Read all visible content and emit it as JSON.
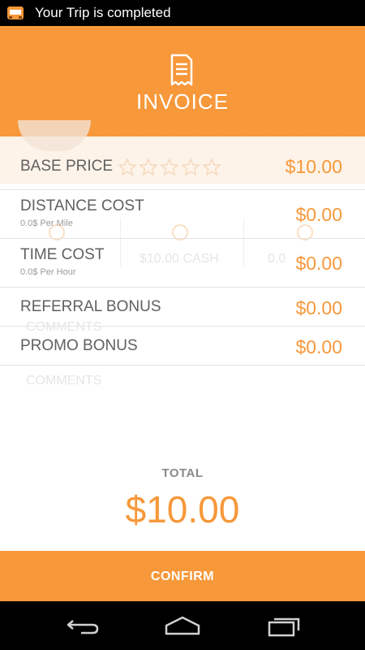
{
  "status_bar": {
    "notification_text": "Your Trip is completed"
  },
  "header": {
    "title": "INVOICE",
    "icon": "receipt-icon"
  },
  "background_ghost": {
    "cash_text": "$10.00 CASH",
    "partial_text": "0.0",
    "comments_text_1": "COMMENTS",
    "comments_text_2": "COMMENTS"
  },
  "invoice": {
    "base_price": {
      "label": "BASE PRICE",
      "amount": "$10.00",
      "rating": 0,
      "max_rating": 5
    },
    "distance_cost": {
      "label": "DISTANCE COST",
      "sub": "0.0$ Per Mile",
      "amount": "$0.00"
    },
    "time_cost": {
      "label": "TIME COST",
      "sub": "0.0$ Per Hour",
      "amount": "$0.00"
    },
    "referral_bonus": {
      "label": "REFERRAL BONUS",
      "amount": "$0.00"
    },
    "promo_bonus": {
      "label": "PROMO BONUS",
      "amount": "$0.00"
    }
  },
  "total": {
    "label": "TOTAL",
    "value": "$10.00"
  },
  "confirm_button": {
    "label": "CONFIRM"
  },
  "colors": {
    "accent": "#f7983a",
    "text_gray": "#606060",
    "status_bar": "#000000"
  },
  "nav_bar": {
    "icons": [
      "back-icon",
      "home-icon",
      "recent-apps-icon"
    ]
  }
}
